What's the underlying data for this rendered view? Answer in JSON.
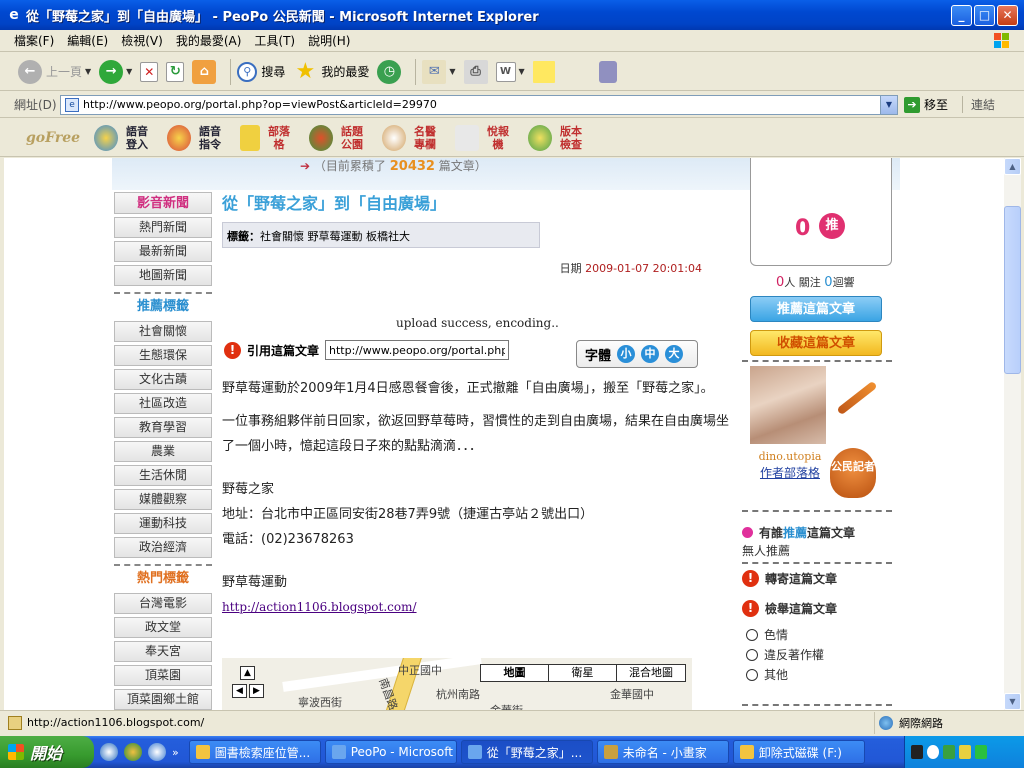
{
  "window": {
    "title": "從「野莓之家」到「自由廣場」 - PeoPo 公民新聞 - Microsoft Internet Explorer",
    "min": "_",
    "max": "□",
    "close": "✕"
  },
  "menubar": [
    "檔案(F)",
    "編輯(E)",
    "檢視(V)",
    "我的最愛(A)",
    "工具(T)",
    "說明(H)"
  ],
  "toolbar": {
    "back": "上一頁",
    "search": "搜尋",
    "favorites": "我的最愛"
  },
  "address": {
    "label": "網址(D)",
    "url": "http://www.peopo.org/portal.php?op=viewPost&articleId=29970",
    "go": "移至",
    "links": "連結"
  },
  "gofree": {
    "logo": "goFree",
    "items": [
      "語音登入",
      "語音指令",
      "部落格",
      "話題公園",
      "名醫專欄",
      "悅報機",
      "版本檢查"
    ]
  },
  "banner": {
    "prefix": "（目前累積了",
    "count": "20432",
    "suffix": "篇文章）"
  },
  "sidenav": {
    "video_news": "影音新聞",
    "news": [
      "熱門新聞",
      "最新新聞",
      "地圖新聞"
    ],
    "rec_tags_head": "推薦標籤",
    "rec_tags": [
      "社會關懷",
      "生態環保",
      "文化古蹟",
      "社區改造",
      "教育學習",
      "農業",
      "生活休閒",
      "媒體觀察",
      "運動科技",
      "政治經濟"
    ],
    "hot_tags_head": "熱門標籤",
    "hot_tags": [
      "台灣電影",
      "政文堂",
      "奉天宮",
      "頂菜園",
      "頂菜園鄉土館"
    ]
  },
  "article": {
    "title": "從「野莓之家」到「自由廣場」",
    "tags_label": "標籤：",
    "tags": "社會關懷  野草莓運動  板橋社大",
    "date_label": "日期",
    "date": "2009-01-07 20:01:04",
    "upload_status": "upload success, encoding..",
    "cite_label": "引用這篇文章",
    "cite_url": "http://www.peopo.org/portal.php?",
    "fontsize_label": "字體",
    "fs_small": "小",
    "fs_medium": "中",
    "fs_large": "大",
    "p1": "野草莓運動於2009年1月4日感恩餐會後，正式撤離「自由廣場」，搬至「野莓之家」。",
    "p2": "一位事務組夥伴前日回家，欲返回野草莓時，習慣性的走到自由廣場，結果在自由廣場坐了一個小時，憶起這段日子來的點點滴滴．．．",
    "p3_1": "野莓之家",
    "p3_2": "地址：台北市中正區同安街28巷7弄9號（捷運古亭站２號出口）",
    "p3_3": "電話：(02)23678263",
    "p4": "野草莓運動",
    "link": "http://action1106.blogspot.com/"
  },
  "map": {
    "tabs": [
      "地圖",
      "衛星",
      "混合地圖"
    ],
    "labels": [
      "中正國中",
      "南昌路",
      "寧波西街",
      "金華街",
      "杭州南路",
      "金華國中"
    ]
  },
  "right": {
    "push_count": "0",
    "push_label": "推",
    "people": "0",
    "people_label": "人 關注",
    "replies": "0",
    "replies_label": "迴響",
    "recommend_btn": "推薦這篇文章",
    "collect_btn": "收藏這篇文章",
    "author_name": "dino.utopia",
    "author_blog": "作者部落格",
    "badge": "公民記者",
    "rec_label_pre": "有誰",
    "rec_label_hl": "推薦",
    "rec_label_post": "這篇文章",
    "no_rec": "無人推薦",
    "forward": "轉寄這篇文章",
    "report": "檢舉這篇文章",
    "report_opts": [
      "色情",
      "違反著作權",
      "其他"
    ]
  },
  "status": {
    "text": "http://action1106.blogspot.com/",
    "zone": "網際網路"
  },
  "taskbar": {
    "start": "開始",
    "tasks": [
      "圖書檢索座位管...",
      "PeoPo - Microsoft ...",
      "從「野莓之家」...",
      "未命名 - 小畫家",
      "卸除式磁碟 (F:)"
    ]
  },
  "colors": {
    "title_blue": "#0048d0",
    "accent_blue": "#3aa0d8",
    "pink": "#e03070",
    "orange": "#e07020"
  }
}
